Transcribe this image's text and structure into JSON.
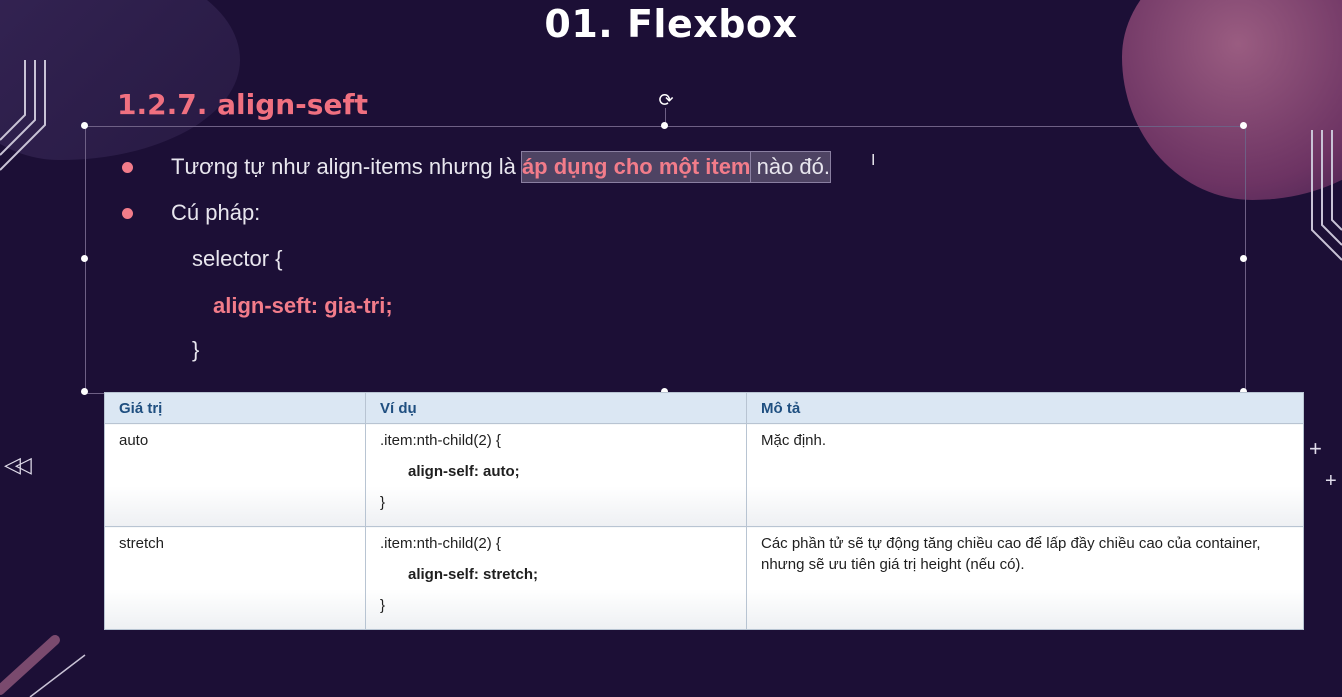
{
  "slide": {
    "title": "01. Flexbox",
    "subtitle": "1.2.7. align-seft"
  },
  "bullets": [
    {
      "before": "Tương tự như align-items nhưng là ",
      "highlight": "áp dụng cho một item",
      "after": " nào đó."
    },
    {
      "text": "Cú pháp:"
    }
  ],
  "code": {
    "selector_open": "selector {",
    "property": "align-seft: gia-tri;",
    "close": "}"
  },
  "table": {
    "headers": [
      "Giá trị",
      "Ví dụ",
      "Mô tả"
    ],
    "rows": [
      {
        "value": "auto",
        "example_open": ".item:nth-child(2) {",
        "example_body": "align-self: auto;",
        "example_close": "}",
        "description": "Mặc định."
      },
      {
        "value": "stretch",
        "example_open": ".item:nth-child(2) {",
        "example_body": "align-self: stretch;",
        "example_close": "}",
        "description": "Các phần tử sẽ tự động tăng chiều cao để lấp đầy chiều cao của container, nhưng sẽ ưu tiên giá trị height (nếu có)."
      }
    ]
  },
  "nav": {
    "back_glyph": "◁◁",
    "plus_glyph": "+"
  },
  "icons": {
    "rotate": "rotate-handle-icon",
    "back": "rewind-icon",
    "plus": "plus-icon"
  },
  "colors": {
    "background": "#1c0f36",
    "accent": "#f27c8a",
    "table_header": "#dbe7f3"
  }
}
